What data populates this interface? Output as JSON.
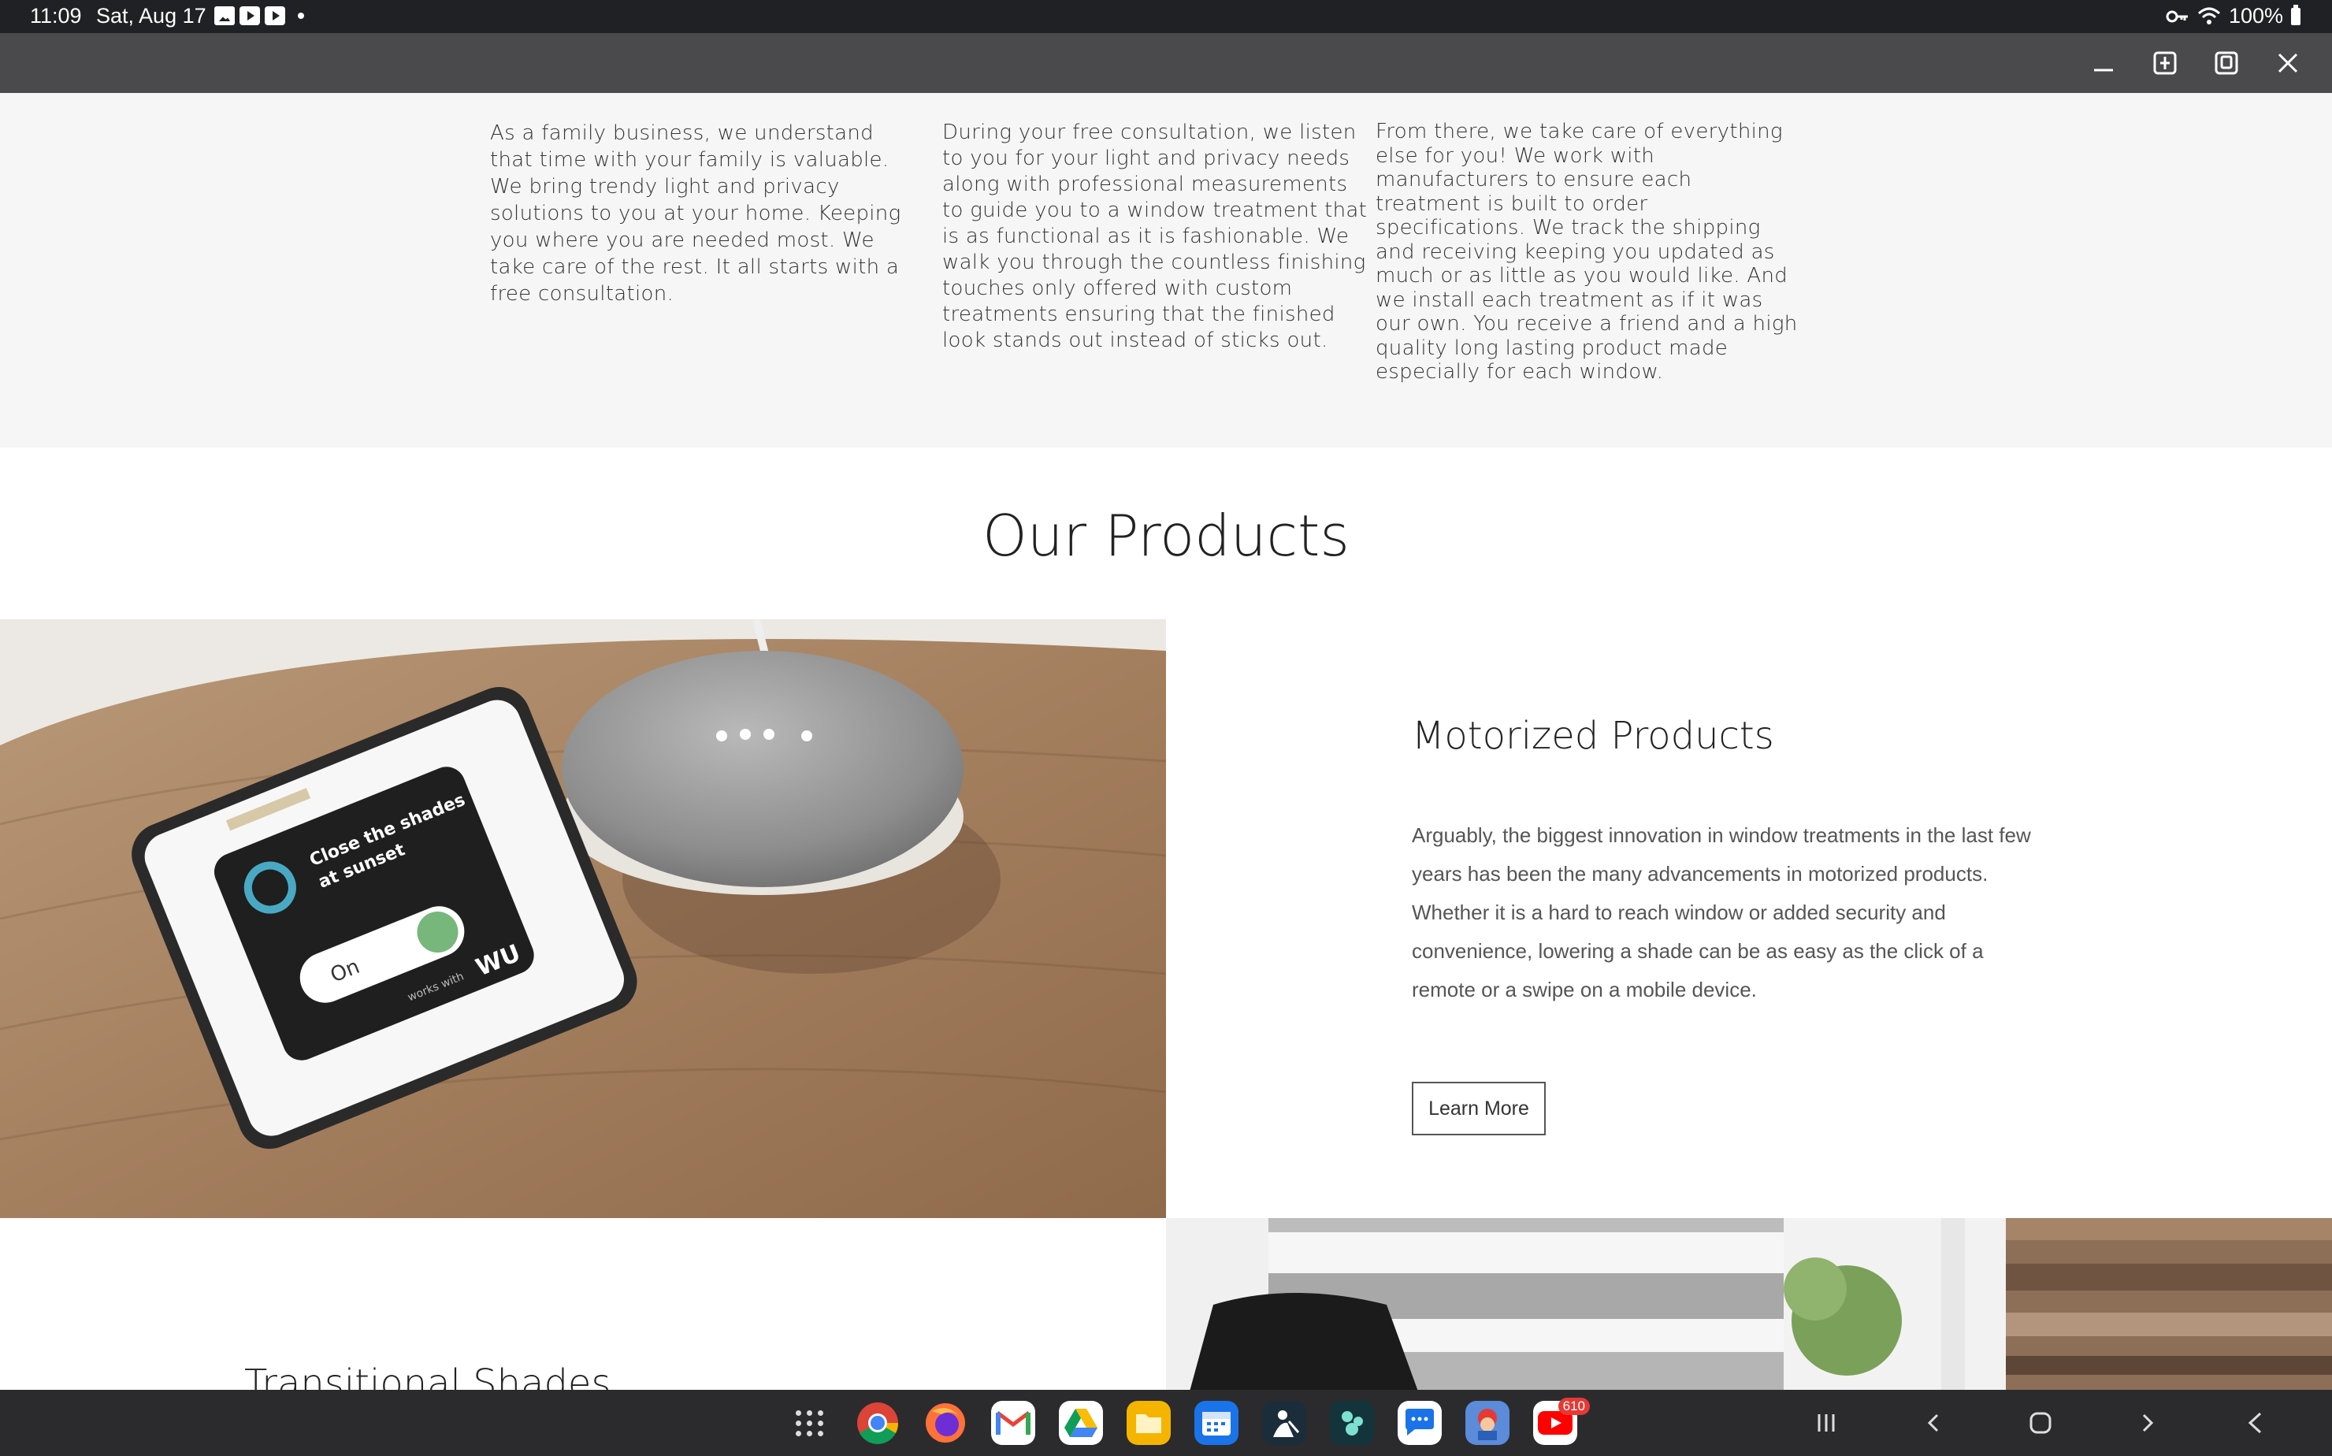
{
  "status_bar": {
    "time": "11:09",
    "date": "Sat, Aug 17",
    "battery": "100%",
    "notification_icons": [
      "gallery-icon",
      "youtube-icon",
      "youtube-icon"
    ]
  },
  "intro": {
    "col1": "As a family business, we understand that time with your family is valuable. We bring trendy light and privacy solutions to you at your home. Keeping you where you are needed most. We take care of the rest. It all starts with a free consultation.",
    "col2": "During your free consultation, we listen to you for your light and privacy needs along with professional measurements to guide you to a window treatment that is as functional as it is fashionable. We walk you through the countless finishing touches only offered with custom treatments ensuring that the finished look stands out instead of sticks out.",
    "col3": "From there, we take care of everything else for you! We work with manufacturers to ensure each treatment is built to order specifications. We track the shipping and receiving keeping you updated as much or as little as you would like. And we install each treatment as if it was our own. You receive a friend and a high quality long lasting product made especially for each window."
  },
  "products": {
    "title": "Our Products",
    "motorized": {
      "title": "Motorized Products",
      "body": "Arguably, the biggest innovation in window treatments in the last few years has been the many advancements in motorized products. Whether it is a hard to reach window or added security and convenience, lowering a shade can be as easy as the click of a remote or a swipe on a mobile device.",
      "button": "Learn More",
      "phone_screen": {
        "card_text_1": "Close the shades",
        "card_text_2": "at sunset",
        "toggle": "On",
        "works_with": "works with",
        "logo": "WU"
      }
    },
    "transitional": {
      "title": "Transitional Shades"
    }
  },
  "taskbar": {
    "apps": [
      "apps-grid",
      "chrome",
      "firefox",
      "gmail",
      "drive",
      "files",
      "calendar",
      "kindle",
      "app-dots",
      "messages",
      "game",
      "youtube"
    ],
    "youtube_badge": "610",
    "colors": {
      "chrome": "#4285f4",
      "gmail": "#ea4335",
      "drive": "#fbbc04",
      "files": "#f4b400",
      "messages": "#1a73e8"
    }
  }
}
